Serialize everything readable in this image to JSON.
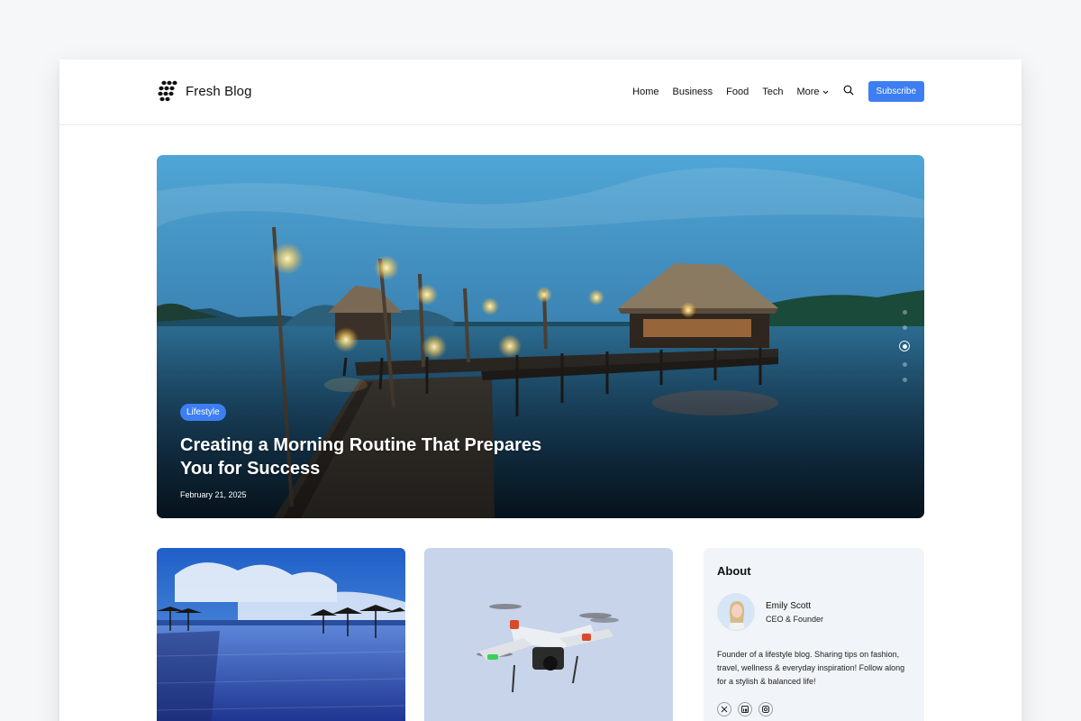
{
  "brand": {
    "name": "Fresh Blog"
  },
  "nav": {
    "items": [
      "Home",
      "Business",
      "Food",
      "Tech"
    ],
    "more_label": "More",
    "subscribe_label": "Subscribe"
  },
  "hero": {
    "category": "Lifestyle",
    "title": "Creating a Morning Routine That Prepares You for Success",
    "date": "February 21, 2025",
    "slide_count": 5,
    "active_slide": 3
  },
  "about": {
    "title": "About",
    "author_name": "Emily Scott",
    "author_role": "CEO & Founder",
    "bio": "Founder of a lifestyle blog. Sharing tips on fashion, travel, wellness & everyday inspiration! Follow along for a stylish & balanced life!",
    "socials": [
      "x-icon",
      "linkedin-icon",
      "instagram-icon"
    ]
  },
  "colors": {
    "accent": "#3d7ff2",
    "page_bg": "#f6f7f9",
    "sidebar_bg": "#f1f4f8"
  }
}
